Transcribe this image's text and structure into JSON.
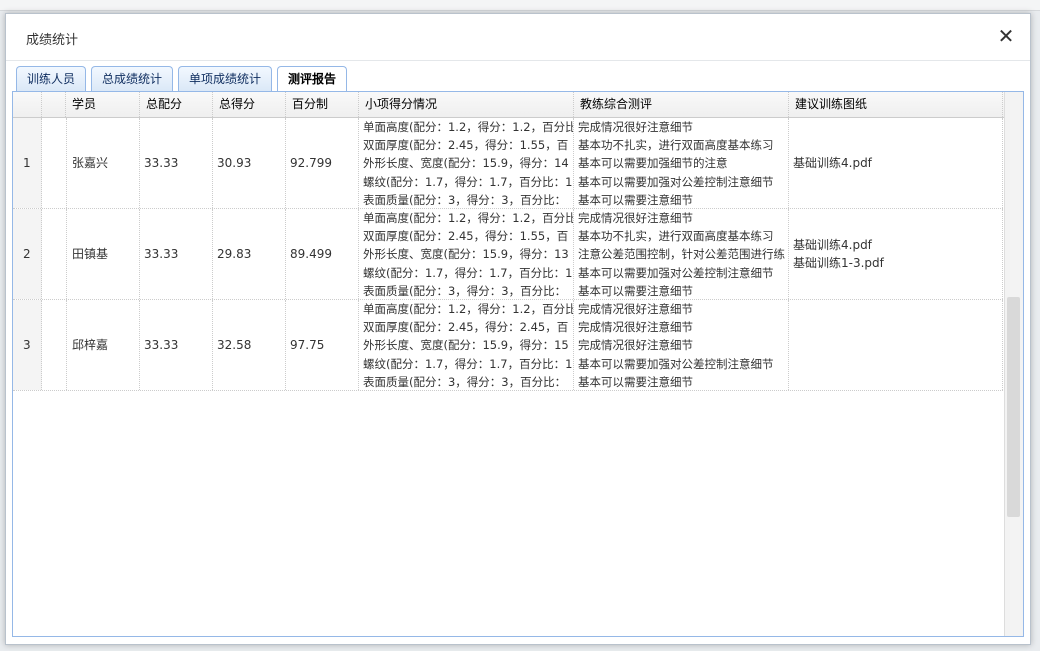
{
  "dialog": {
    "title": "成绩统计"
  },
  "tabs": [
    "训练人员",
    "总成绩统计",
    "单项成绩统计",
    "测评报告"
  ],
  "grid": {
    "columns": [
      "学员",
      "总配分",
      "总得分",
      "百分制",
      "小项得分情况",
      "教练综合测评",
      "建议训练图纸"
    ],
    "rows": [
      {
        "index": "1",
        "name": "张嘉兴",
        "total_score": "33.33",
        "score": "30.93",
        "percent": "92.799",
        "items": [
          "单面高度(配分：1.2，得分：1.2，百分比",
          "双面厚度(配分：2.45，得分：1.55，百",
          "外形长度、宽度(配分：15.9，得分：14",
          "螺纹(配分：1.7，得分：1.7，百分比：1",
          "表面质量(配分：3，得分：3，百分比："
        ],
        "comments": [
          "完成情况很好注意细节",
          "基本功不扎实，进行双面高度基本练习",
          "基本可以需要加强细节的注意",
          "基本可以需要加强对公差控制注意细节",
          "基本可以需要注意细节"
        ],
        "drawings": [
          "基础训练4.pdf"
        ]
      },
      {
        "index": "2",
        "name": "田镇基",
        "total_score": "33.33",
        "score": "29.83",
        "percent": "89.499",
        "items": [
          "单面高度(配分：1.2，得分：1.2，百分比",
          "双面厚度(配分：2.45，得分：1.55，百",
          "外形长度、宽度(配分：15.9，得分：13",
          "螺纹(配分：1.7，得分：1.7，百分比：1",
          "表面质量(配分：3，得分：3，百分比："
        ],
        "comments": [
          "完成情况很好注意细节",
          "基本功不扎实，进行双面高度基本练习",
          "注意公差范围控制，针对公差范围进行练",
          "基本可以需要加强对公差控制注意细节",
          "基本可以需要注意细节"
        ],
        "drawings": [
          "基础训练4.pdf",
          "基础训练1-3.pdf"
        ]
      },
      {
        "index": "3",
        "name": "邱梓嘉",
        "total_score": "33.33",
        "score": "32.58",
        "percent": "97.75",
        "items": [
          "单面高度(配分：1.2，得分：1.2，百分比",
          "双面厚度(配分：2.45，得分：2.45，百",
          "外形长度、宽度(配分：15.9，得分：15",
          "螺纹(配分：1.7，得分：1.7，百分比：1",
          "表面质量(配分：3，得分：3，百分比："
        ],
        "comments": [
          "完成情况很好注意细节",
          "完成情况很好注意细节",
          "完成情况很好注意细节",
          "基本可以需要加强对公差控制注意细节",
          "基本可以需要注意细节"
        ],
        "drawings": []
      }
    ]
  }
}
